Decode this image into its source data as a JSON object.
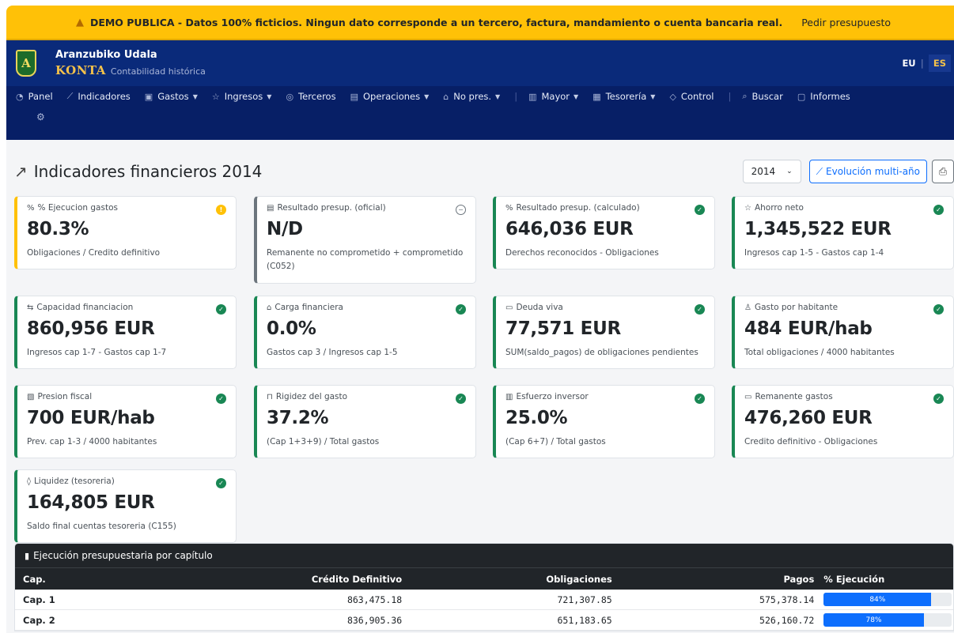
{
  "banner": {
    "message": "DEMO PUBLICA - Datos 100% ficticios. Ningun dato corresponde a un tercero, factura, mandamiento o cuenta bancaria real.",
    "cta": "Pedir presupuesto"
  },
  "header": {
    "logo_letter": "A",
    "org_name": "Aranzubiko Udala",
    "app_name": "KONTA",
    "app_subtitle": "Contabilidad histórica",
    "lang_eu": "EU",
    "lang_es": "ES"
  },
  "nav": {
    "panel": "Panel",
    "indicadores": "Indicadores",
    "gastos": "Gastos",
    "ingresos": "Ingresos",
    "terceros": "Terceros",
    "operaciones": "Operaciones",
    "no_pres": "No pres.",
    "mayor": "Mayor",
    "tesoreria": "Tesorería",
    "control": "Control",
    "buscar": "Buscar",
    "informes": "Informes"
  },
  "page": {
    "title": "Indicadores financieros 2014",
    "year": "2014",
    "evolution_button": "Evolución multi-año"
  },
  "cards": [
    {
      "label": "% Ejecucion gastos",
      "value": "80.3%",
      "desc": "Obligaciones / Credito definitivo",
      "status": "warning"
    },
    {
      "label": "Resultado presup. (oficial)",
      "value": "N/D",
      "desc": "Remanente no comprometido + comprometido (C052)",
      "status": "neutral"
    },
    {
      "label": "Resultado presup. (calculado)",
      "value": "646,036 EUR",
      "desc": "Derechos reconocidos - Obligaciones",
      "status": "ok"
    },
    {
      "label": "Ahorro neto",
      "value": "1,345,522 EUR",
      "desc": "Ingresos cap 1-5 - Gastos cap 1-4",
      "status": "ok"
    },
    {
      "label": "Capacidad financiacion",
      "value": "860,956 EUR",
      "desc": "Ingresos cap 1-7 - Gastos cap 1-7",
      "status": "ok"
    },
    {
      "label": "Carga financiera",
      "value": "0.0%",
      "desc": "Gastos cap 3 / Ingresos cap 1-5",
      "status": "ok"
    },
    {
      "label": "Deuda viva",
      "value": "77,571 EUR",
      "desc": "SUM(saldo_pagos) de obligaciones pendientes",
      "status": "ok"
    },
    {
      "label": "Gasto por habitante",
      "value": "484 EUR/hab",
      "desc": "Total obligaciones / 4000 habitantes",
      "status": "ok"
    },
    {
      "label": "Presion fiscal",
      "value": "700 EUR/hab",
      "desc": "Prev. cap 1-3 / 4000 habitantes",
      "status": "ok"
    },
    {
      "label": "Rigidez del gasto",
      "value": "37.2%",
      "desc": "(Cap 1+3+9) / Total gastos",
      "status": "ok"
    },
    {
      "label": "Esfuerzo inversor",
      "value": "25.0%",
      "desc": "(Cap 6+7) / Total gastos",
      "status": "ok"
    },
    {
      "label": "Remanente gastos",
      "value": "476,260 EUR",
      "desc": "Credito definitivo - Obligaciones",
      "status": "ok"
    },
    {
      "label": "Liquidez (tesoreria)",
      "value": "164,805 EUR",
      "desc": "Saldo final cuentas tesoreria (C155)",
      "status": "ok"
    }
  ],
  "table": {
    "title": "Ejecución presupuestaria por capítulo",
    "headers": {
      "cap": "Cap.",
      "credito": "Crédito Definitivo",
      "obligaciones": "Obligaciones",
      "pagos": "Pagos",
      "ejecucion": "% Ejecución"
    },
    "rows": [
      {
        "cap": "Cap. 1",
        "credito": "863,475.18",
        "obligaciones": "721,307.85",
        "pagos": "575,378.14",
        "pct_label": "84%",
        "pct": 84
      },
      {
        "cap": "Cap. 2",
        "credito": "836,905.36",
        "obligaciones": "651,183.65",
        "pagos": "526,160.72",
        "pct_label": "78%",
        "pct": 78
      }
    ]
  }
}
